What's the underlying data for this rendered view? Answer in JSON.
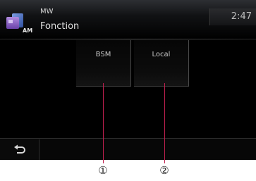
{
  "header": {
    "band": "MW",
    "title": "Fonction",
    "clock": "2:47",
    "source_icon": "am-radio-icon",
    "source_badge": "AM"
  },
  "buttons": [
    {
      "label": "BSM"
    },
    {
      "label": "Local"
    }
  ],
  "footer": {
    "back_icon": "return-arrow-icon"
  },
  "callouts": [
    "①",
    "②"
  ],
  "colors": {
    "screen_background": "#000000",
    "callout_line": "#c0204f",
    "icon_purple": "#8c5bc6",
    "icon_blue": "#3a62b8"
  }
}
